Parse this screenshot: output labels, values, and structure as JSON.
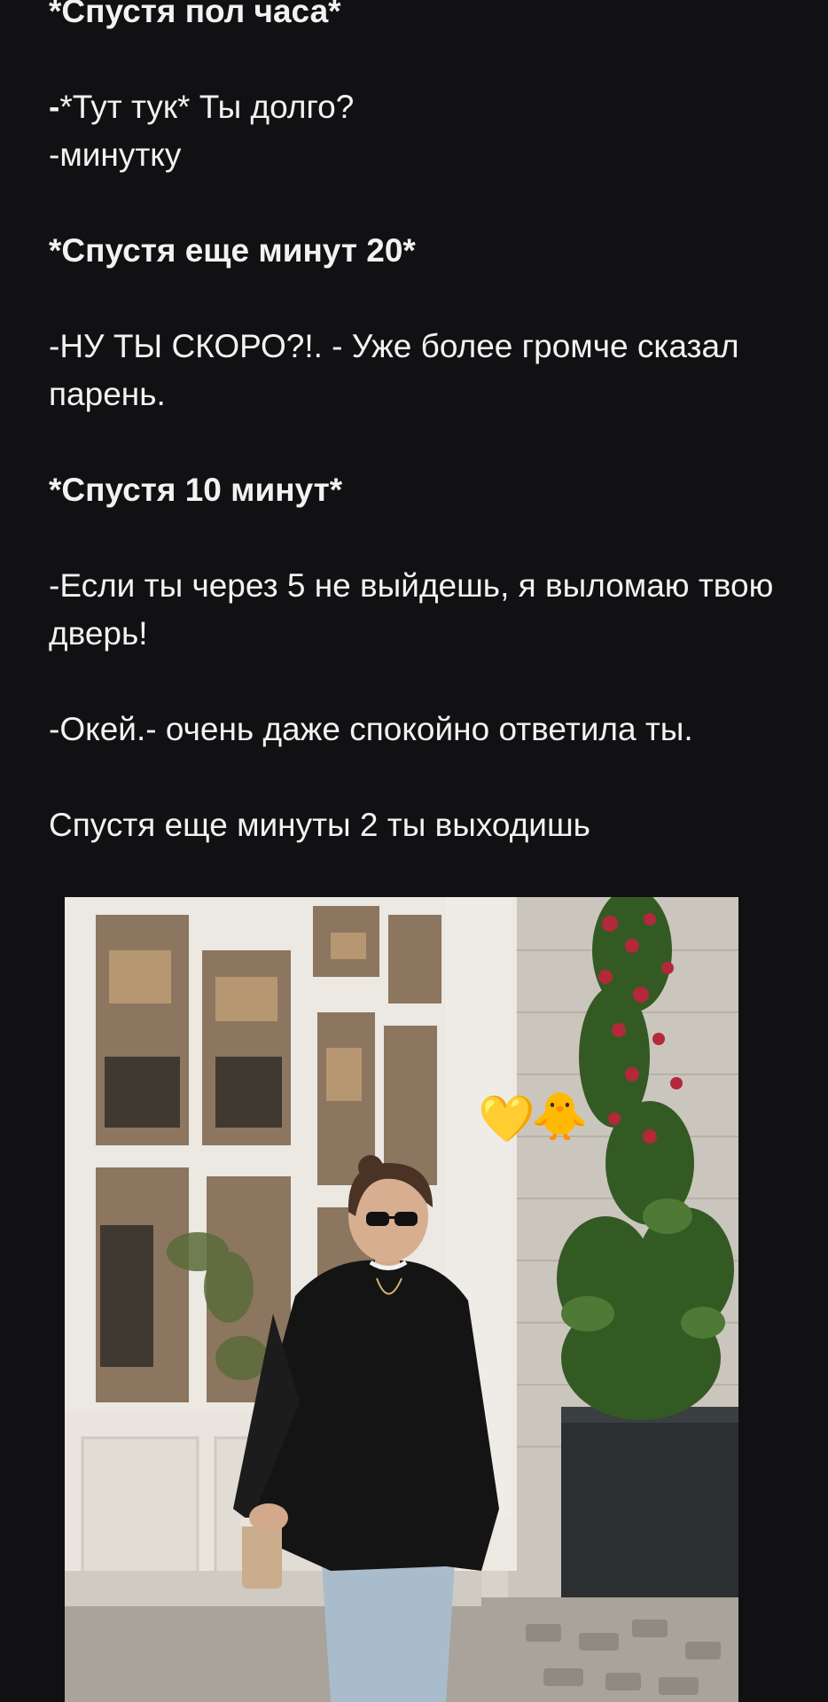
{
  "post": {
    "lines": [
      {
        "text": "*Спустя пол часа*",
        "bold": true
      },
      {
        "text": "-*Тут тук* Ты долго?",
        "bold": false
      },
      {
        "text": "-минутку",
        "bold": false
      },
      {
        "text": "*Спустя еще минут 20*",
        "bold": true
      },
      {
        "text": "-НУ ТЫ СКОРО?!. - Уже более громче сказал парень.",
        "bold": false
      },
      {
        "text": "*Спустя 10 минут*",
        "bold": true
      },
      {
        "text": "-Если ты через 5 не выйдешь, я выломаю твою дверь!",
        "bold": false
      },
      {
        "text": "-Окей.- очень даже спокойно ответила ты.",
        "bold": false
      },
      {
        "text": "Спустя еще минуты 2 ты выходишь",
        "bold": false
      }
    ],
    "line1_prefix": "-",
    "line1_rest": "*Тут тук* Ты долго?"
  },
  "photo": {
    "stickers": [
      {
        "emoji": "💛",
        "name": "yellow-heart-icon"
      },
      {
        "emoji": "🐥",
        "name": "baby-chick-icon"
      }
    ]
  }
}
